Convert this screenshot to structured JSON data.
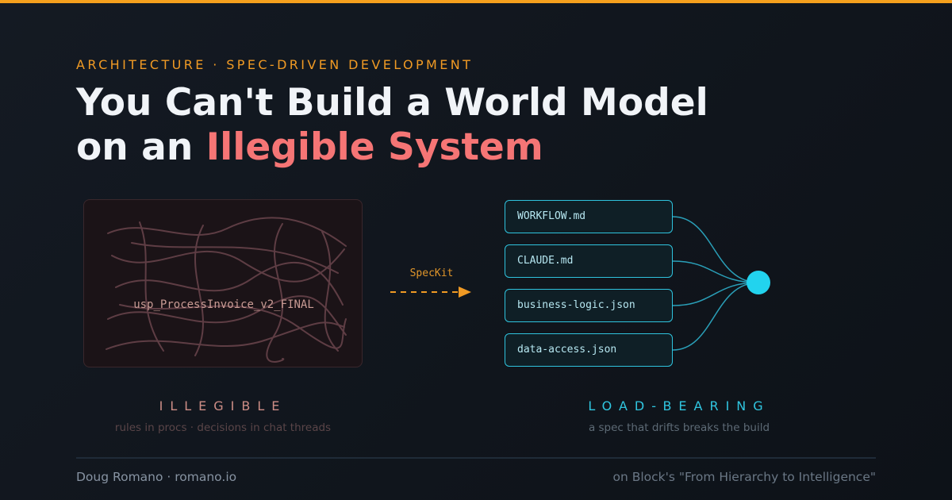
{
  "header": {
    "eyebrow": "ARCHITECTURE · SPEC-DRIVEN DEVELOPMENT",
    "title_line1": "You Can't Build a World Model",
    "title_line2_prefix": "on an ",
    "title_line2_accent": "Illegible System"
  },
  "left_panel": {
    "proc_name": "usp_ProcessInvoice_v2_FINAL",
    "label": "ILLEGIBLE",
    "subtitle": "rules in procs · decisions in chat threads"
  },
  "transition": {
    "label": "SpecKit"
  },
  "right_panel": {
    "files": [
      "WORKFLOW.md",
      "CLAUDE.md",
      "business-logic.json",
      "data-access.json"
    ],
    "label": "LOAD-BEARING",
    "subtitle": "a spec that drifts breaks the build"
  },
  "footer": {
    "author": "Doug Romano · romano.io",
    "reference": "on Block's \"From Hierarchy to Intelligence\""
  },
  "colors": {
    "accent_orange": "#f5a01d",
    "accent_red": "#f57575",
    "accent_cyan": "#2fc3de",
    "background": "#12171f"
  },
  "icons": [
    "dashed-arrow-icon",
    "hub-node-icon"
  ]
}
